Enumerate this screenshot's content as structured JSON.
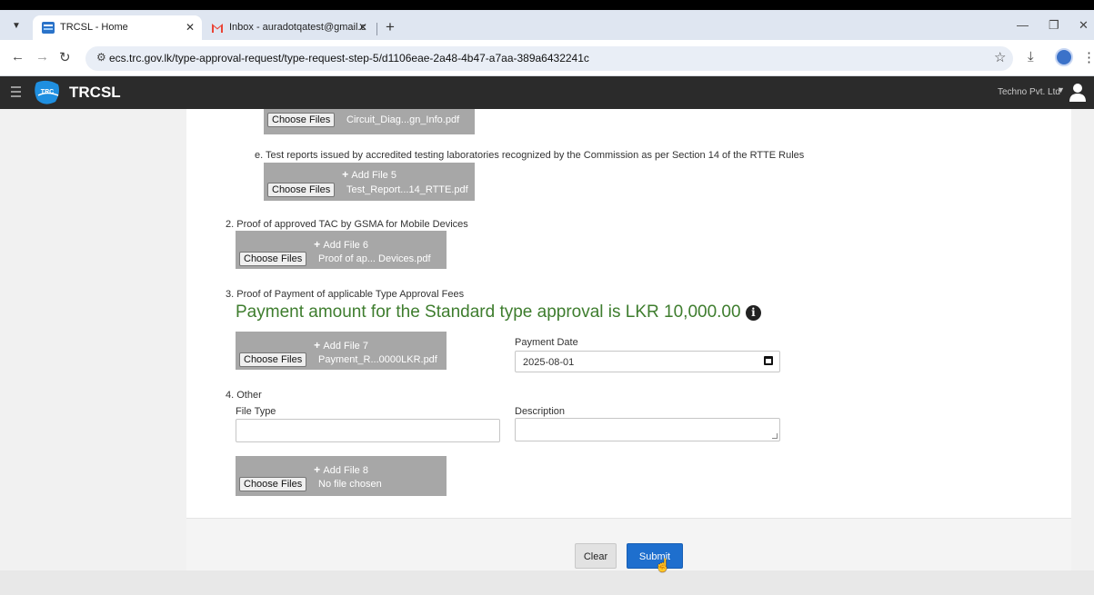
{
  "browser": {
    "tabs": [
      {
        "title": "TRCSL - Home",
        "active": true
      },
      {
        "title": "Inbox - auradotqatest@gmail.c",
        "active": false
      }
    ],
    "url": "ecs.trc.gov.lk/type-approval-request/type-request-step-5/d1106eae-2a48-4b47-a7aa-389a6432241c"
  },
  "app": {
    "brand": "TRCSL",
    "logo_text": "TRC",
    "company": "Techno Pvt. Ltd"
  },
  "form": {
    "choose_label": "Choose Files",
    "item_d": {
      "file_name": "Circuit_Diag...gn_Info.pdf"
    },
    "item_e": {
      "label": "e. Test reports issued by accredited testing laboratories recognized by the Commission as per Section 14 of the RTTE Rules",
      "add_label": "Add File 5",
      "file_name": "Test_Report...14_RTTE.pdf"
    },
    "item_2": {
      "label": "2. Proof of approved TAC by GSMA for Mobile Devices",
      "add_label": "Add File 6",
      "file_name": "Proof of ap... Devices.pdf"
    },
    "item_3": {
      "label": "3. Proof of Payment of applicable Type Approval Fees",
      "payment_text": "Payment amount for the Standard type approval is LKR 10,000.00",
      "add_label": "Add File 7",
      "file_name": "Payment_R...0000LKR.pdf",
      "payment_date_label": "Payment Date",
      "payment_date_value": "2025-08-01"
    },
    "item_4": {
      "label": "4. Other",
      "file_type_label": "File Type",
      "description_label": "Description",
      "add_label": "Add File 8",
      "file_name": "No file chosen"
    }
  },
  "actions": {
    "clear": "Clear",
    "submit": "Submit"
  },
  "colors": {
    "appbar": "#2b2b2b",
    "payment_text": "#3e7d2e",
    "submit": "#1e6fce",
    "upload_box": "#a7a7a7"
  }
}
